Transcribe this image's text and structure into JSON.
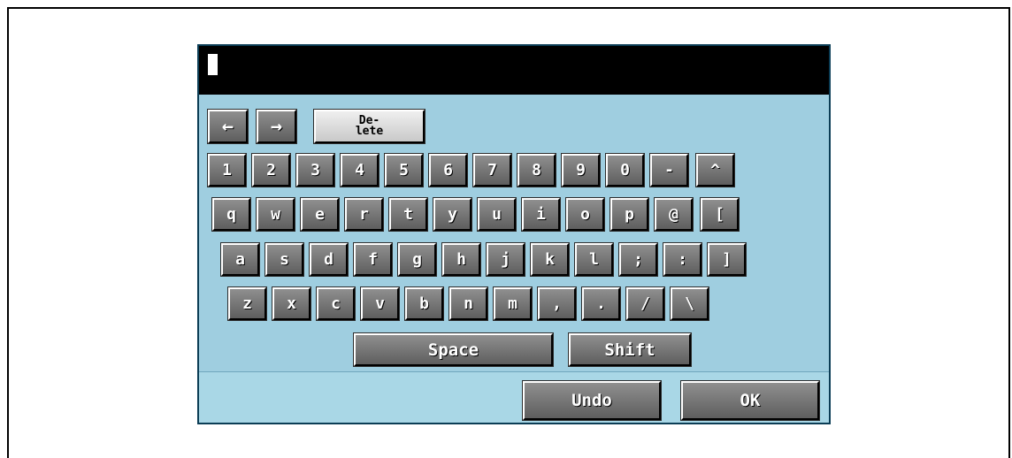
{
  "input": {
    "value": ""
  },
  "nav": {
    "left_arrow": "←",
    "right_arrow": "→",
    "delete_line1": "De-",
    "delete_line2": "lete"
  },
  "keys": {
    "row1": [
      "1",
      "2",
      "3",
      "4",
      "5",
      "6",
      "7",
      "8",
      "9",
      "0",
      "-",
      "^"
    ],
    "row2": [
      "q",
      "w",
      "e",
      "r",
      "t",
      "y",
      "u",
      "i",
      "o",
      "p",
      "@",
      "["
    ],
    "row3": [
      "a",
      "s",
      "d",
      "f",
      "g",
      "h",
      "j",
      "k",
      "l",
      ";",
      ":",
      "]"
    ],
    "row4": [
      "z",
      "x",
      "c",
      "v",
      "b",
      "n",
      "m",
      ",",
      ".",
      "/",
      "\\"
    ]
  },
  "actions": {
    "space": "Space",
    "shift": "Shift",
    "undo": "Undo",
    "ok": "OK"
  },
  "colors": {
    "panel_bg": "#a9d7e6",
    "keyboard_bg": "#9fcee0",
    "key_bg": "#777777",
    "input_bg": "#000000"
  }
}
